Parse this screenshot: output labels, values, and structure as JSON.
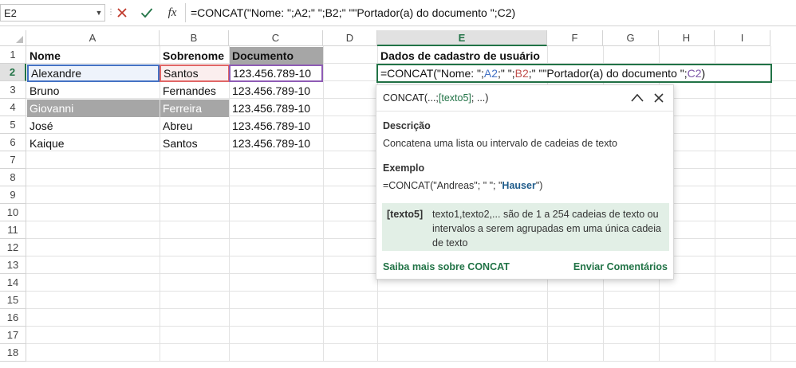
{
  "formula_bar": {
    "name_box": "E2",
    "fx_label": "fx",
    "formula": "=CONCAT(\"Nome: \";A2;\" \";B2;\" \"\"Portador(a) do documento \";C2)"
  },
  "columns": [
    "A",
    "B",
    "C",
    "D",
    "E",
    "F",
    "G",
    "H",
    "I"
  ],
  "rows": [
    "1",
    "2",
    "3",
    "4",
    "5",
    "6",
    "7",
    "8",
    "9",
    "10",
    "11",
    "12",
    "13",
    "14",
    "15",
    "16",
    "17",
    "18"
  ],
  "active": {
    "column": "E",
    "row": "2"
  },
  "table": {
    "headers": [
      "Nome",
      "Sobrenome",
      "Documento"
    ],
    "rows": [
      [
        "Alexandre",
        "Santos",
        "123.456.789-10"
      ],
      [
        "Bruno",
        "Fernandes",
        "123.456.789-10"
      ],
      [
        "Giovanni",
        "Ferreira",
        "123.456.789-10"
      ],
      [
        "José",
        "Abreu",
        "123.456.789-10"
      ],
      [
        "Kaique",
        "Santos",
        "123.456.789-10"
      ]
    ]
  },
  "e1_title": "Dados de cadastro de usuário",
  "edit_formula": {
    "p1": "=CONCAT(\"Nome: \";",
    "ref1": "A2",
    "p2": ";\" \";",
    "ref2": "B2",
    "p3": ";\" \"\"Portador(a) do documento \";",
    "ref3": "C2",
    "p4": ")"
  },
  "tooltip": {
    "signature_pre": "CONCAT(...; ",
    "signature_arg": "[texto5]",
    "signature_post": "; ...)",
    "desc_label": "Descrição",
    "desc_text": "Concatena uma lista ou intervalo de cadeias de texto",
    "example_label": "Exemplo",
    "example_pre": "=CONCAT(\"Andreas\"; \" \"; \"",
    "example_bold": "Hauser",
    "example_post": "\")",
    "arg_name": "[texto5]",
    "arg_desc": "texto1,texto2,... são de 1 a 254 cadeias de texto ou intervalos a serem agrupadas em uma única cadeia de texto",
    "learn_more": "Saiba mais sobre CONCAT",
    "feedback": "Enviar Comentários"
  },
  "colors": {
    "excel_green": "#217346",
    "ref_blue": "#4472c4",
    "ref_red": "#c0504d",
    "ref_purple": "#7e57a8",
    "cell_gray": "#a6a6a6"
  }
}
